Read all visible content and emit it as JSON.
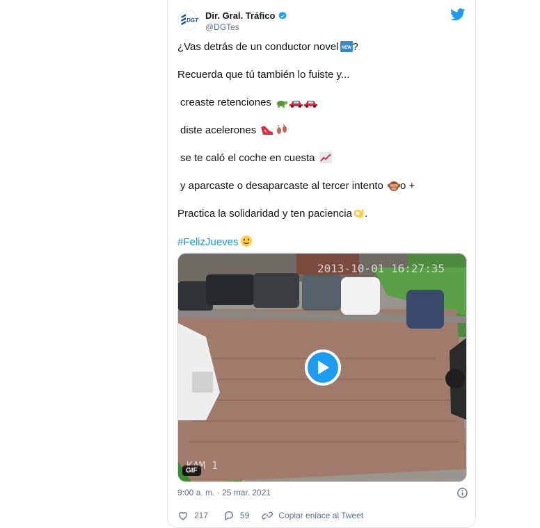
{
  "tweet": {
    "author_name": "Dir. Gral. Tráfico",
    "author_handle": "@DGTes",
    "logo_text": "DGT",
    "lines": [
      {
        "text": "¿Vas detrás de un conductor novel",
        "emoji": "new-button",
        "suffix": "?"
      },
      {
        "text": "Recuerda que tú también lo fuiste y..."
      },
      {
        "text": "creaste retenciones",
        "emoji": "turtle-car-car"
      },
      {
        "text": "diste acelerones",
        "emoji": "shoe-footprints"
      },
      {
        "text": "se te caló el coche en cuesta",
        "emoji": "chart-increasing"
      },
      {
        "text": "y aparcaste o desaparcaste al tercer intento",
        "emoji": "see-no-evil-monkey",
        "suffix": "o +"
      },
      {
        "text": "Practica la solidaridad y ten paciencia",
        "emoji": "ok-hand",
        "suffix": "."
      }
    ],
    "hashtag": "#FelizJueves",
    "media": {
      "overlay_timestamp": "2013-10-01 16:27:35",
      "overlay_cam": "KAM 1",
      "badge": "GIF"
    },
    "timestamp": "9:00 a. m. · 25 mar. 2021",
    "likes": "217",
    "replies": "59",
    "copy_link_label": "Copiar enlace al Tweet"
  },
  "colors": {
    "link": "#1b95e0",
    "twitter_blue": "#1d9bf0",
    "secondary_text": "#5b7083"
  },
  "icons": [
    "dgt-logo-icon",
    "verified-icon",
    "twitter-bird-icon",
    "play-icon",
    "info-icon",
    "heart-icon",
    "reply-icon",
    "link-icon"
  ]
}
